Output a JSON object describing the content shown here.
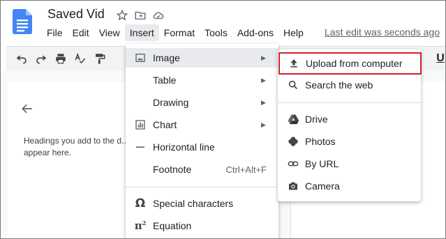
{
  "document": {
    "title": "Saved Vid",
    "last_edit": "Last edit was seconds ago"
  },
  "menubar": {
    "items": [
      "File",
      "Edit",
      "View",
      "Insert",
      "Format",
      "Tools",
      "Add-ons",
      "Help"
    ],
    "active": "Insert"
  },
  "toolbar": {
    "underline_label": "U"
  },
  "outline": {
    "hint": "Headings you add to the d... appear here."
  },
  "insert_menu": {
    "items": [
      {
        "label": "Image",
        "icon": "image-icon",
        "submenu": true,
        "highlighted": true
      },
      {
        "label": "Table",
        "icon": "",
        "submenu": true
      },
      {
        "label": "Drawing",
        "icon": "",
        "submenu": true
      },
      {
        "label": "Chart",
        "icon": "chart-icon",
        "submenu": true
      },
      {
        "label": "Horizontal line",
        "icon": "horizontal-line-icon",
        "submenu": false
      },
      {
        "label": "Footnote",
        "icon": "",
        "shortcut": "Ctrl+Alt+F"
      },
      {
        "label": "Special characters",
        "icon": "omega-icon",
        "submenu": false
      },
      {
        "label": "Equation",
        "icon": "pi-icon",
        "submenu": false
      }
    ]
  },
  "image_submenu": {
    "items": [
      {
        "label": "Upload from computer",
        "icon": "upload-icon",
        "highlighted_box": true
      },
      {
        "label": "Search the web",
        "icon": "search-icon"
      },
      {
        "label": "Drive",
        "icon": "drive-icon"
      },
      {
        "label": "Photos",
        "icon": "photos-icon"
      },
      {
        "label": "By URL",
        "icon": "link-icon"
      },
      {
        "label": "Camera",
        "icon": "camera-icon"
      }
    ]
  },
  "colors": {
    "docs_blue": "#4285f4",
    "highlight_box": "#d3202a",
    "menu_hover": "#e8eaed"
  }
}
